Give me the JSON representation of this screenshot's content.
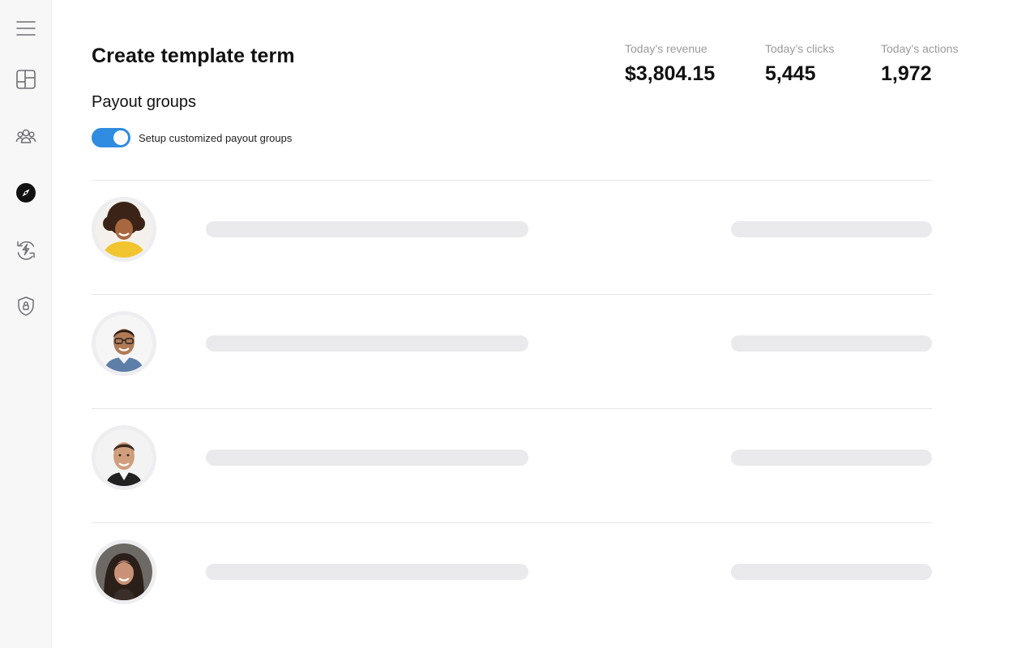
{
  "sidebar": {
    "items": [
      {
        "icon": "menu-icon"
      },
      {
        "icon": "dashboard-icon"
      },
      {
        "icon": "users-icon"
      },
      {
        "icon": "compass-icon",
        "active": true
      },
      {
        "icon": "lightning-refresh-icon"
      },
      {
        "icon": "shield-lock-icon"
      }
    ]
  },
  "page": {
    "title": "Create template term",
    "section_title": "Payout groups",
    "toggle_label": "Setup customized payout groups",
    "toggle_on": true
  },
  "stats": {
    "revenue": {
      "label": "Today’s revenue",
      "value": "$3,804.15"
    },
    "clicks": {
      "label": "Today’s clicks",
      "value": "5,445"
    },
    "actions": {
      "label": "Today’s actions",
      "value": "1,972"
    }
  },
  "colors": {
    "accent": "#2f8ce0",
    "placeholder_bar": "#eaeaec",
    "sidebar_bg": "#f7f7f8"
  },
  "rows": [
    {
      "avatar": "avatar-woman-curly-hair"
    },
    {
      "avatar": "avatar-man-glasses"
    },
    {
      "avatar": "avatar-man-short-hair"
    },
    {
      "avatar": "avatar-woman-dark-hair"
    }
  ]
}
